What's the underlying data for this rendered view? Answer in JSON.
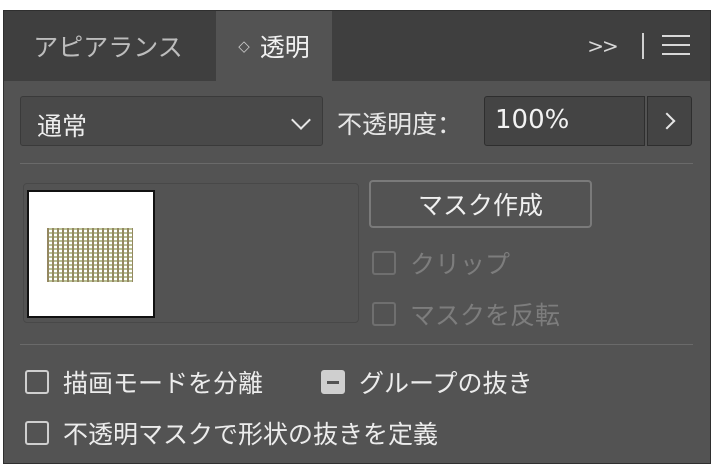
{
  "tabs": {
    "appearance": "アピアランス",
    "transparency_updown": "◇",
    "transparency": "透明"
  },
  "toolbar": {
    "overflow": ">>",
    "overflow_icon": "chevron-double-right-icon",
    "menu_icon": "hamburger-menu-icon"
  },
  "blend": {
    "mode": "通常",
    "chevron_icon": "chevron-down-icon"
  },
  "opacity": {
    "label": "不透明度：",
    "value": "100%",
    "stepper_icon": "chevron-right-icon"
  },
  "mask": {
    "button": "マスク作成",
    "clip": {
      "label": "クリップ",
      "checked": false,
      "enabled": false
    },
    "invert": {
      "label": "マスクを反転",
      "checked": false,
      "enabled": false
    }
  },
  "options": {
    "isolate": {
      "label": "描画モードを分離",
      "checked": false
    },
    "knockout": {
      "label": "グループの抜き",
      "state": "mixed"
    },
    "define_knockout": {
      "label": "不透明マスクで形状の抜きを定義",
      "checked": false
    }
  },
  "colors": {
    "panel_bg": "#535353",
    "tab_bar_bg": "#3f3f3f",
    "field_bg": "#444444",
    "text": "#e6e6e6",
    "disabled_text": "#7d7d7d"
  }
}
